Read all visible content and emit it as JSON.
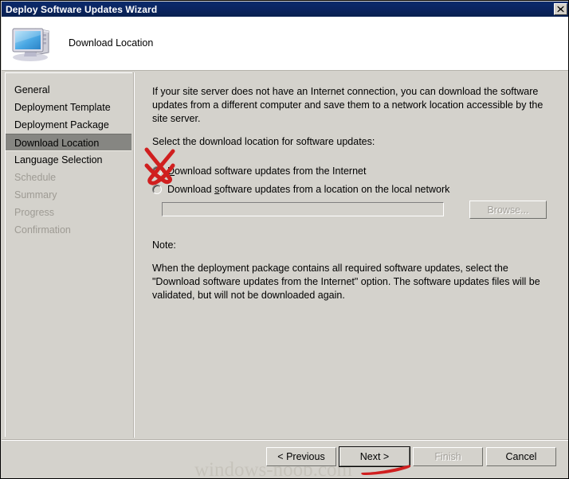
{
  "window": {
    "title": "Deploy Software Updates Wizard",
    "close_label": "✕"
  },
  "header": {
    "icon": "computer-icon",
    "title": "Download Location"
  },
  "sidebar": {
    "items": [
      {
        "label": "General",
        "state": "done"
      },
      {
        "label": "Deployment Template",
        "state": "done"
      },
      {
        "label": "Deployment Package",
        "state": "done"
      },
      {
        "label": "Download Location",
        "state": "active"
      },
      {
        "label": "Language Selection",
        "state": "done"
      },
      {
        "label": "Schedule",
        "state": "upcoming"
      },
      {
        "label": "Summary",
        "state": "upcoming"
      },
      {
        "label": "Progress",
        "state": "upcoming"
      },
      {
        "label": "Confirmation",
        "state": "upcoming"
      }
    ]
  },
  "content": {
    "intro": "If your site server does not have an Internet connection, you can download the software updates from a different computer and save them to a network location accessible by the site server.",
    "prompt": "Select the download location for software updates:",
    "option_internet": {
      "label_pre": "",
      "accel": "D",
      "label_post": "ownload software updates from the Internet",
      "checked": true
    },
    "option_local": {
      "label_pre": "Download ",
      "accel": "s",
      "label_post": "oftware updates from a location on the local network",
      "checked": false
    },
    "path_value": "",
    "path_placeholder": "",
    "browse_label": "Browse...",
    "note_label": "Note:",
    "note_body": "When the deployment package contains all required software updates, select the \"Download software updates from the Internet\" option. The software updates files will be validated, but will not be downloaded again."
  },
  "footer": {
    "previous_label": "< Previous",
    "next_label": "Next >",
    "finish_label": "Finish",
    "cancel_label": "Cancel"
  },
  "watermark": {
    "text": "windows-noob.com"
  },
  "colors": {
    "titlebar": "#0a2460",
    "dialog_bg": "#d4d2cc",
    "selection": "#868682",
    "annotation": "#d01f1f",
    "disabled_text": "#a3a09a"
  }
}
